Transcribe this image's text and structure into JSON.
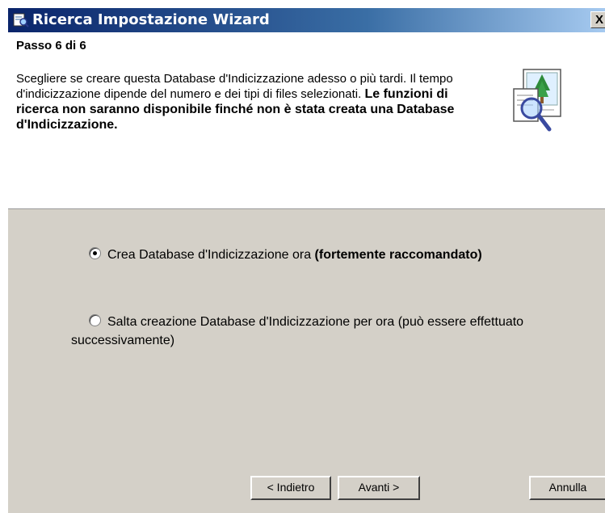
{
  "window": {
    "title": "Ricerca Impostazione Wizard",
    "close_label": "X"
  },
  "header": {
    "step": "Passo 6 di 6",
    "description_plain": "Scegliere se creare questa Database d'Indicizzazione adesso o più tardi. Il tempo d'indicizzazione dipende del numero e dei tipi di files selezionati. ",
    "description_bold": "Le funzioni di ricerca non saranno disponibile finché non è stata creata una Database d'Indicizzazione.",
    "icon": "search-wizard-icon"
  },
  "options": [
    {
      "label_plain": "Crea Database d'Indicizzazione ora ",
      "label_bold": "(fortemente raccomandato)",
      "selected": true
    },
    {
      "label_plain": "Salta creazione Database d'Indicizzazione per ora (può essere effettuato successivamente)",
      "selected": false
    }
  ],
  "buttons": {
    "back": "< Indietro",
    "next": "Avanti >",
    "cancel": "Annulla"
  },
  "colors": {
    "titlebar": "#0a246a",
    "dialog_bg": "#d4d0c8",
    "header_bg": "#ffffff"
  }
}
